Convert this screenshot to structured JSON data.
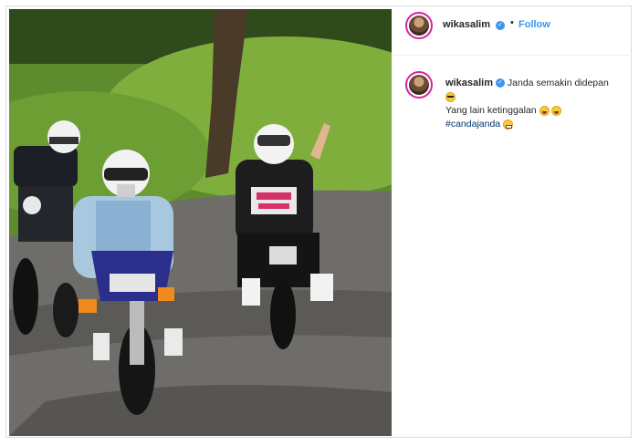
{
  "post": {
    "username": "wikasalim",
    "verified_icon": "verified-badge-icon",
    "separator": "•",
    "follow_label": "Follow"
  },
  "caption": {
    "username": "wikasalim",
    "line1": "Janda semakin didepan",
    "line2": "Yang lain ketinggalan",
    "hashtag": "#candajanda",
    "emojis": [
      "sunglasses-emoji",
      "rolling-laughing-emoji",
      "rolling-laughing-emoji",
      "grinning-squint-emoji"
    ]
  },
  "colors": {
    "accent": "#3897f0",
    "text": "#262626",
    "hashtag": "#00376b",
    "avatar_ring": "#d6249f"
  }
}
